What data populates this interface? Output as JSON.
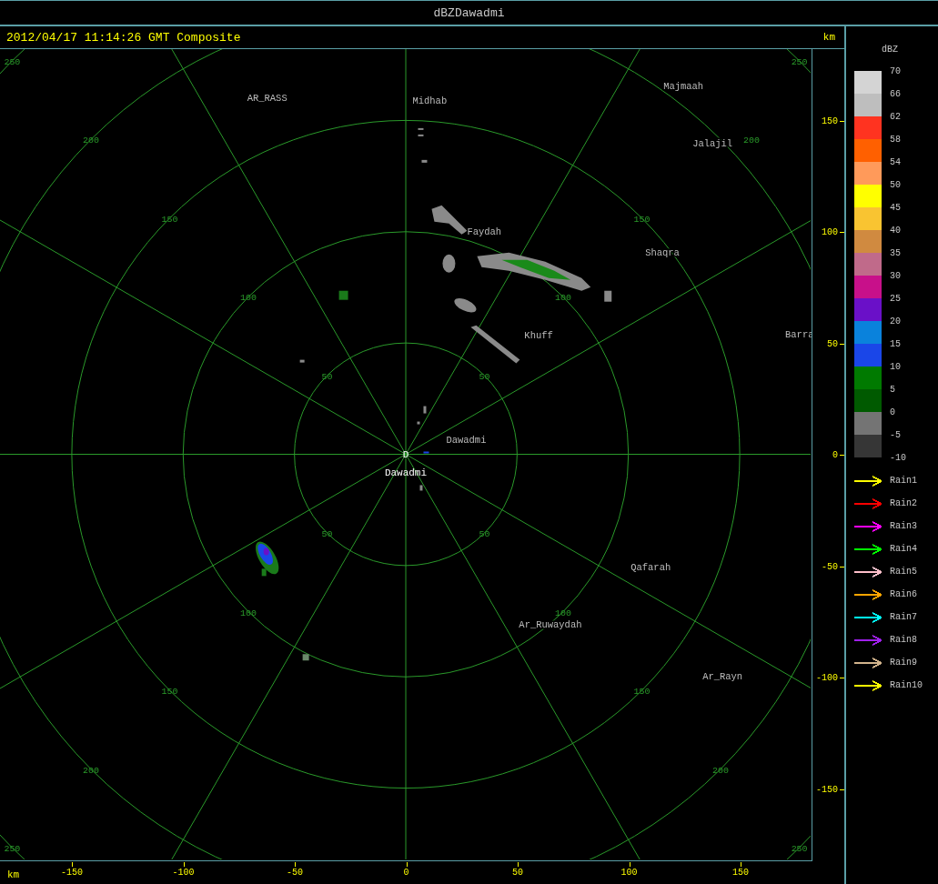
{
  "window": {
    "title": "dBZDawadmi"
  },
  "header": {
    "timestamp": "2012/04/17 11:14:26 GMT Composite",
    "y_unit": "km"
  },
  "map": {
    "rings": [
      {
        "labels": [
          "50",
          "50",
          "50",
          "50"
        ]
      },
      {
        "labels": [
          "100",
          "100",
          "100",
          "100"
        ]
      },
      {
        "labels": [
          "150",
          "150",
          "150",
          "150"
        ]
      },
      {
        "labels": [
          "200",
          "200",
          "200",
          "200"
        ]
      },
      {
        "labels": [
          "250",
          "250",
          "250",
          "250"
        ]
      }
    ],
    "site": {
      "marker": "D",
      "name": "Dawadmi"
    },
    "cities": [
      {
        "name": "AR_RASS"
      },
      {
        "name": "Midhab"
      },
      {
        "name": "Majmaah"
      },
      {
        "name": "Jalajil"
      },
      {
        "name": "Faydah"
      },
      {
        "name": "Shaqra"
      },
      {
        "name": "Barra"
      },
      {
        "name": "Khuff"
      },
      {
        "name": "Dawadmi"
      },
      {
        "name": "Qafarah"
      },
      {
        "name": "Ar_Ruwaydah"
      },
      {
        "name": "Ar_Rayn"
      }
    ]
  },
  "x_axis": {
    "unit": "km",
    "ticks": [
      "-150",
      "-100",
      "-50",
      "0",
      "50",
      "100",
      "150"
    ]
  },
  "y_axis": {
    "ticks": [
      "150",
      "100",
      "50",
      "0",
      "-50",
      "-100",
      "-150"
    ]
  },
  "legend": {
    "title": "dBZ",
    "bins": [
      {
        "color": "#d4d4d4"
      },
      {
        "color": "#bebebe"
      },
      {
        "color": "#ff3320"
      },
      {
        "color": "#ff6000"
      },
      {
        "color": "#ff9a5a"
      },
      {
        "color": "#ffff00"
      },
      {
        "color": "#f9c431"
      },
      {
        "color": "#d08a40"
      },
      {
        "color": "#c06a8a"
      },
      {
        "color": "#c8108a"
      },
      {
        "color": "#6a10c8"
      },
      {
        "color": "#0a82dc"
      },
      {
        "color": "#1a46e8"
      },
      {
        "color": "#007a00"
      },
      {
        "color": "#005a00"
      },
      {
        "color": "#747474"
      },
      {
        "color": "#363636"
      }
    ],
    "values": [
      "70",
      "66",
      "62",
      "58",
      "54",
      "50",
      "45",
      "40",
      "35",
      "30",
      "25",
      "20",
      "15",
      "10",
      "5",
      "0",
      "-5",
      "-10"
    ],
    "tracks": [
      {
        "name": "Rain1",
        "color": "#ffff00"
      },
      {
        "name": "Rain2",
        "color": "#ff0000"
      },
      {
        "name": "Rain3",
        "color": "#ff00ff"
      },
      {
        "name": "Rain4",
        "color": "#00ff00"
      },
      {
        "name": "Rain5",
        "color": "#ffc0cb"
      },
      {
        "name": "Rain6",
        "color": "#ffa500"
      },
      {
        "name": "Rain7",
        "color": "#00ffff"
      },
      {
        "name": "Rain8",
        "color": "#a020f0"
      },
      {
        "name": "Rain9",
        "color": "#d2b48c"
      },
      {
        "name": "Rain10",
        "color": "#ffff00"
      }
    ]
  }
}
